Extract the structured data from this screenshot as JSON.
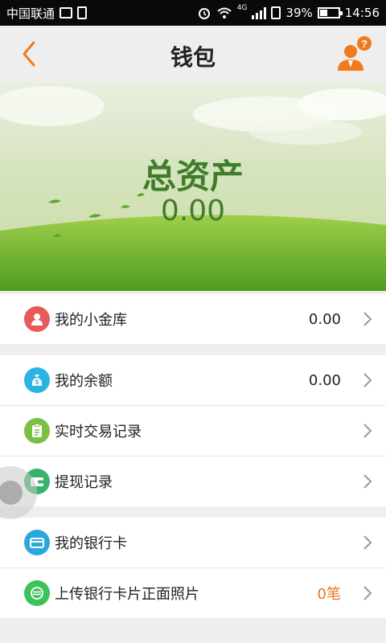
{
  "status_bar": {
    "carrier": "中国联通",
    "network": "4G",
    "battery": "39%",
    "time": "14:56"
  },
  "navbar": {
    "title": "钱包",
    "back_icon": "chevron-left-icon",
    "help_icon": "user-help-icon"
  },
  "banner": {
    "label": "总资产",
    "value": "0.00"
  },
  "groups": [
    {
      "items": [
        {
          "label": "我的小金库",
          "value": "0.00",
          "icon": "person-icon",
          "color": "#e85a5a"
        }
      ]
    },
    {
      "items": [
        {
          "label": "我的余额",
          "value": "0.00",
          "icon": "money-bag-icon",
          "color": "#2bb3e6"
        },
        {
          "label": "实时交易记录",
          "value": "",
          "icon": "clipboard-icon",
          "color": "#7bc043"
        },
        {
          "label": "提现记录",
          "value": "",
          "icon": "wallet-icon",
          "color": "#38b36a"
        }
      ]
    },
    {
      "items": [
        {
          "label": "我的银行卡",
          "value": "",
          "icon": "bank-card-icon",
          "color": "#2aa8dd"
        },
        {
          "label": "上传银行卡片正面照片",
          "value": "0笔",
          "icon": "card-upload-icon",
          "color": "#3cc25a"
        }
      ]
    }
  ],
  "colors": {
    "accent": "#f07a1e",
    "banner_text": "#3f7d2a"
  }
}
